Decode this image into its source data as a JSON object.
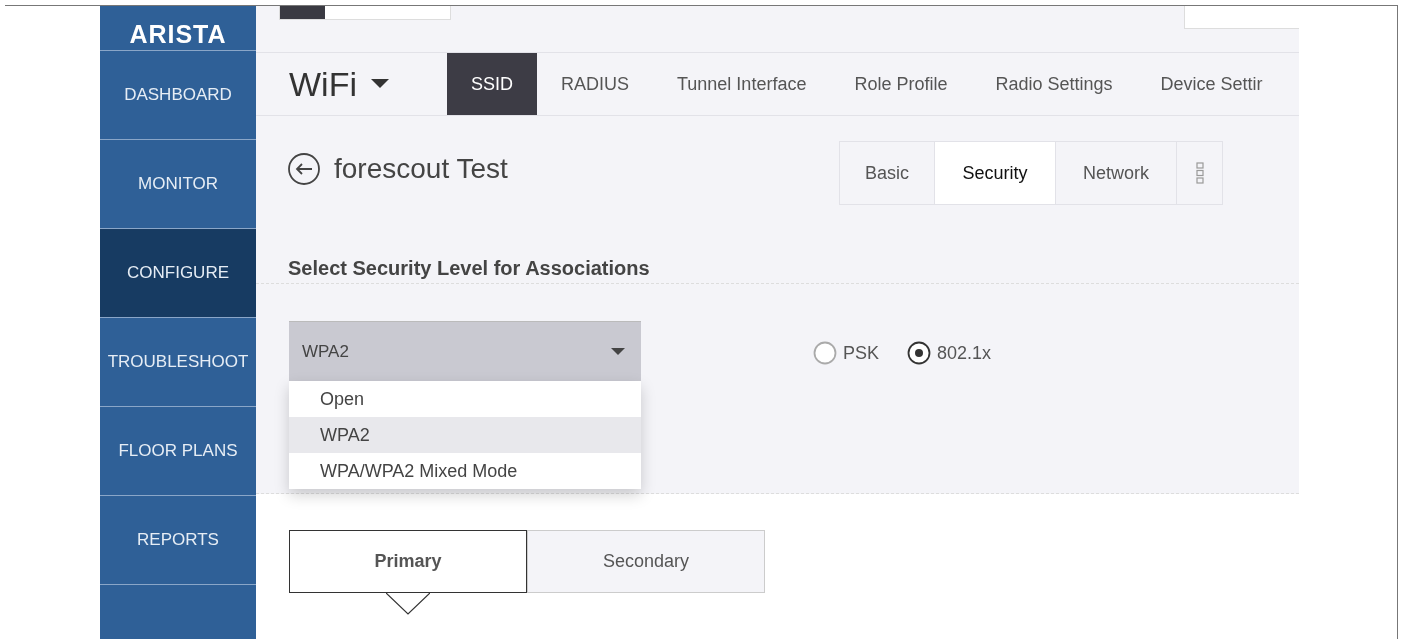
{
  "logo": "ARISTA",
  "sidebar": {
    "items": [
      {
        "label": "DASHBOARD",
        "selected": false
      },
      {
        "label": "MONITOR",
        "selected": false
      },
      {
        "label": "CONFIGURE",
        "selected": true
      },
      {
        "label": "TROUBLESHOOT",
        "selected": false
      },
      {
        "label": "FLOOR PLANS",
        "selected": false
      },
      {
        "label": "REPORTS",
        "selected": false
      }
    ]
  },
  "module": {
    "label": "WiFi"
  },
  "nav_tabs": [
    {
      "label": "SSID",
      "selected": true
    },
    {
      "label": "RADIUS",
      "selected": false
    },
    {
      "label": "Tunnel Interface",
      "selected": false
    },
    {
      "label": "Role Profile",
      "selected": false
    },
    {
      "label": "Radio Settings",
      "selected": false
    },
    {
      "label": "Device Settir",
      "selected": false
    }
  ],
  "page_title": "forescout Test",
  "section_tabs": [
    {
      "label": "Basic",
      "selected": false
    },
    {
      "label": "Security",
      "selected": true
    },
    {
      "label": "Network",
      "selected": false
    }
  ],
  "section_heading": "Select Security Level for Associations",
  "security_select": {
    "value": "WPA2",
    "expanded": true,
    "options": [
      {
        "label": "Open",
        "selected": false
      },
      {
        "label": "WPA2",
        "selected": true
      },
      {
        "label": "WPA/WPA2 Mixed Mode",
        "selected": false
      }
    ]
  },
  "auth_mode": [
    {
      "label": "PSK",
      "selected": false
    },
    {
      "label": "802.1x",
      "selected": true
    }
  ],
  "server_tabs": [
    {
      "label": "Primary",
      "selected": true
    },
    {
      "label": "Secondary",
      "selected": false
    }
  ]
}
